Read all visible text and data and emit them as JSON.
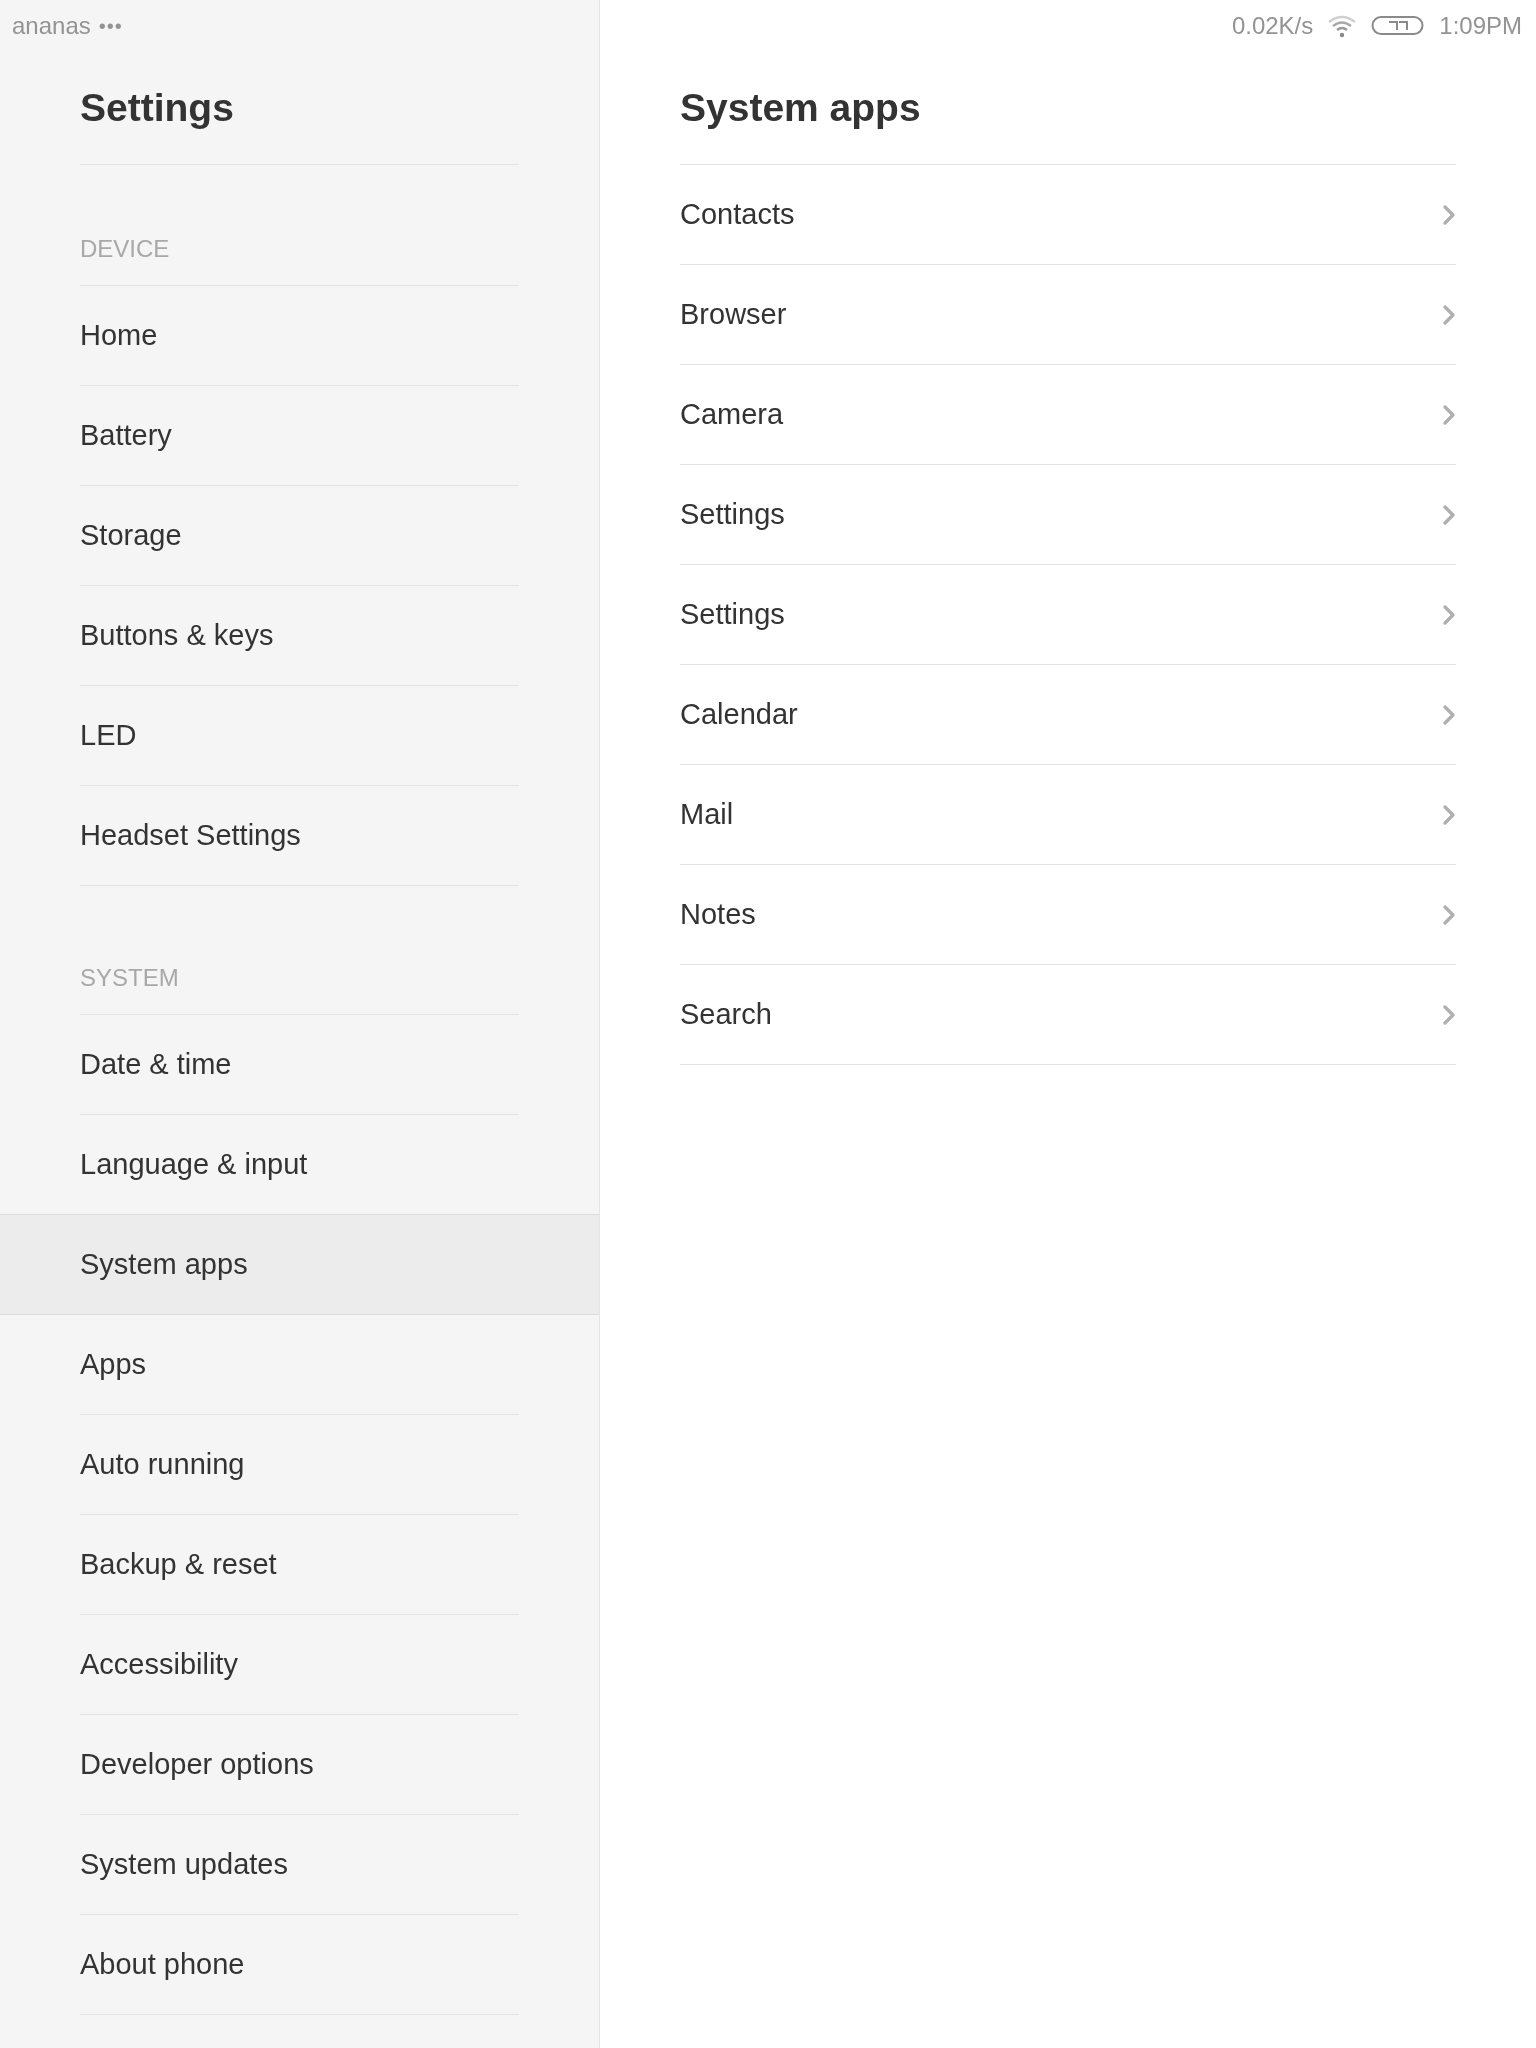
{
  "status_bar": {
    "carrier": "ananas",
    "notifications": "•••",
    "speed": "0.02K/s",
    "time": "1:09PM"
  },
  "sidebar": {
    "title": "Settings",
    "sections": [
      {
        "header": "DEVICE",
        "items": [
          {
            "label": "Home",
            "selected": false
          },
          {
            "label": "Battery",
            "selected": false
          },
          {
            "label": "Storage",
            "selected": false
          },
          {
            "label": "Buttons & keys",
            "selected": false
          },
          {
            "label": "LED",
            "selected": false
          },
          {
            "label": "Headset Settings",
            "selected": false
          }
        ]
      },
      {
        "header": "SYSTEM",
        "items": [
          {
            "label": "Date & time",
            "selected": false
          },
          {
            "label": "Language & input",
            "selected": false
          },
          {
            "label": "System apps",
            "selected": true
          },
          {
            "label": "Apps",
            "selected": false
          },
          {
            "label": "Auto running",
            "selected": false
          },
          {
            "label": "Backup & reset",
            "selected": false
          },
          {
            "label": "Accessibility",
            "selected": false
          },
          {
            "label": "Developer options",
            "selected": false
          },
          {
            "label": "System updates",
            "selected": false
          },
          {
            "label": "About phone",
            "selected": false
          }
        ]
      }
    ]
  },
  "content": {
    "title": "System apps",
    "items": [
      {
        "label": "Contacts"
      },
      {
        "label": "Browser"
      },
      {
        "label": "Camera"
      },
      {
        "label": "Settings"
      },
      {
        "label": "Settings"
      },
      {
        "label": "Calendar"
      },
      {
        "label": "Mail"
      },
      {
        "label": "Notes"
      },
      {
        "label": "Search"
      }
    ]
  }
}
